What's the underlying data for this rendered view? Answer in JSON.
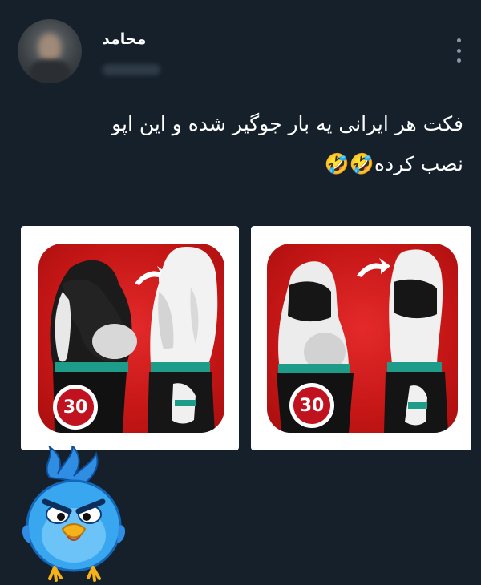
{
  "tweet": {
    "author_name": "محامد",
    "text_line1": "فکت هر ایرانی یه بار جوگیر شده و این اپو",
    "text_line2": "نصب کرده🤣🤣"
  },
  "media": [
    {
      "badge_number": "30"
    },
    {
      "badge_number": "30"
    }
  ],
  "colors": {
    "background": "#15202b",
    "text": "#ffffff",
    "icon_red": "#d61f1f",
    "muted": "#8899a6"
  },
  "icons": {
    "more": "more-vertical-icon",
    "sticker": "angry-blue-bird-sticker"
  }
}
